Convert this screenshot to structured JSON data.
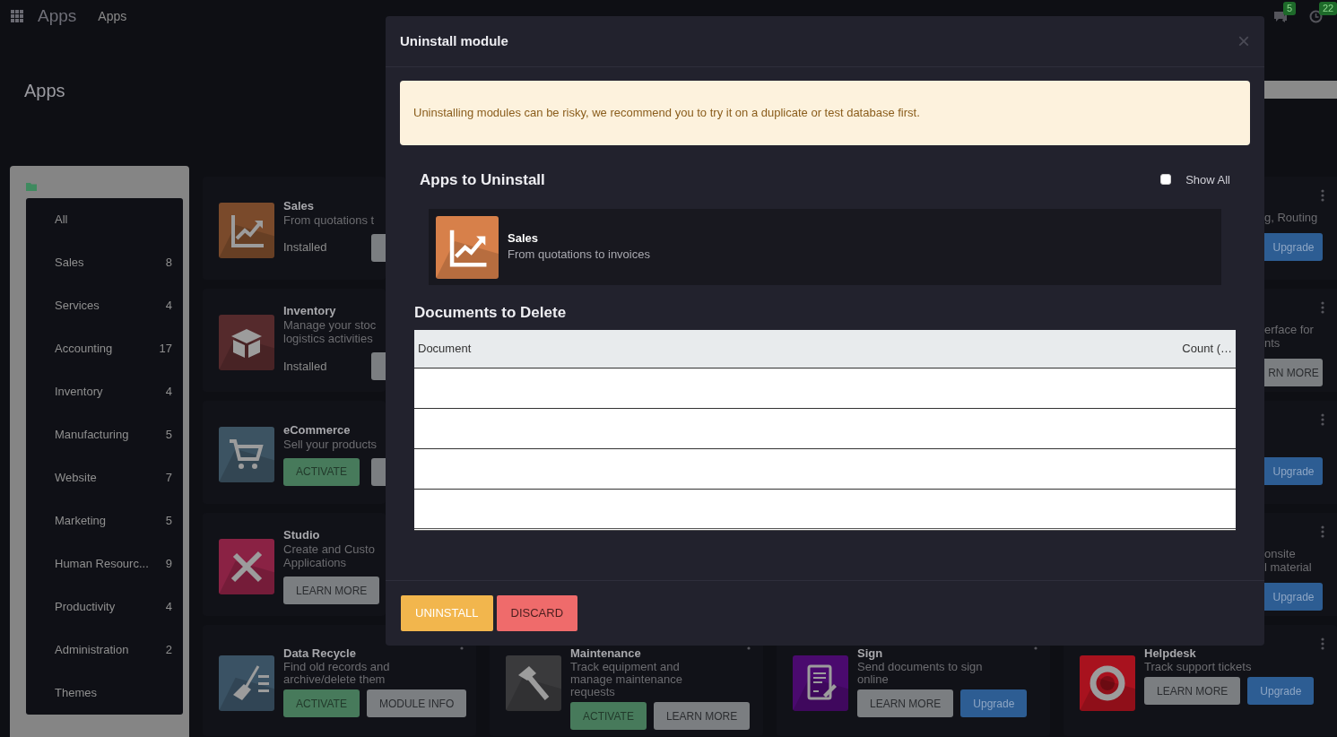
{
  "topbar": {
    "brand": "Apps",
    "menu": [
      "Apps"
    ],
    "notifications": [
      {
        "kind": "chat",
        "count": "5"
      },
      {
        "kind": "activity",
        "count": "22"
      }
    ]
  },
  "page_title": "Apps",
  "categories": [
    {
      "label": "All"
    },
    {
      "label": "Sales",
      "count": "8"
    },
    {
      "label": "Services",
      "count": "4"
    },
    {
      "label": "Accounting",
      "count": "17"
    },
    {
      "label": "Inventory",
      "count": "4"
    },
    {
      "label": "Manufacturing",
      "count": "5"
    },
    {
      "label": "Website",
      "count": "7"
    },
    {
      "label": "Marketing",
      "count": "5"
    },
    {
      "label": "Human Resourc...",
      "count": "9"
    },
    {
      "label": "Productivity",
      "count": "4"
    },
    {
      "label": "Administration",
      "count": "2"
    },
    {
      "label": "Themes"
    }
  ],
  "apps_left": [
    {
      "title": "Sales",
      "description": [
        "From quotations t"
      ],
      "kind": "chart",
      "status": "Installed",
      "buttons": [
        {
          "kind": "covered"
        }
      ]
    },
    {
      "title": "Inventory",
      "description": [
        "Manage your stoc",
        "logistics activities"
      ],
      "kind": "box",
      "status": "Installed",
      "buttons": [
        {
          "kind": "covered"
        }
      ]
    },
    {
      "title": "eCommerce",
      "description": [
        "Sell your products"
      ],
      "kind": "cart",
      "buttons": [
        {
          "kind": "activate",
          "label": "ACTIVATE"
        },
        {
          "kind": "covered"
        }
      ]
    },
    {
      "title": "Studio",
      "description": [
        "Create and Custo",
        "Applications"
      ],
      "kind": "tools",
      "buttons": [
        {
          "kind": "learn",
          "label": "LEARN MORE"
        }
      ]
    }
  ],
  "apps_bottom": [
    {
      "title": "Data Recycle",
      "description": [
        "Find old records and",
        "archive/delete them"
      ],
      "kind": "broom",
      "buttons": [
        {
          "kind": "activate",
          "label": "ACTIVATE"
        },
        {
          "kind": "learn",
          "label": "MODULE INFO"
        }
      ]
    },
    {
      "title": "Maintenance",
      "description": [
        "Track equipment and",
        "manage maintenance",
        "requests"
      ],
      "kind": "hammer",
      "buttons": [
        {
          "kind": "activate",
          "label": "ACTIVATE"
        },
        {
          "kind": "learn",
          "label": "LEARN MORE"
        }
      ]
    },
    {
      "title": "Sign",
      "description": [
        "Send documents to sign",
        "online"
      ],
      "kind": "sign",
      "buttons": [
        {
          "kind": "learn",
          "label": "LEARN MORE"
        },
        {
          "kind": "upgrade",
          "label": "Upgrade"
        }
      ]
    },
    {
      "title": "Helpdesk",
      "description": [
        "Track support tickets"
      ],
      "kind": "lifebuoy",
      "buttons": [
        {
          "kind": "learn",
          "label": "LEARN MORE"
        },
        {
          "kind": "upgrade",
          "label": "Upgrade"
        }
      ]
    }
  ],
  "apps_right_edge": [
    {
      "description": [
        "g, Routing"
      ],
      "button": {
        "kind": "upgrade",
        "label": "Upgrade"
      }
    },
    {
      "description": [
        "erface for",
        "nts"
      ],
      "button": {
        "kind": "learn",
        "label": "RN MORE"
      }
    },
    {
      "button": {
        "kind": "upgrade",
        "label": "Upgrade"
      }
    },
    {
      "description": [
        "onsite",
        "l material"
      ],
      "button": {
        "kind": "upgrade",
        "label": "Upgrade"
      }
    }
  ],
  "modal": {
    "title": "Uninstall module",
    "close": "×",
    "warning": "Uninstalling modules can be risky, we recommend you to try it on a duplicate or test database first.",
    "apps_heading": "Apps to Uninstall",
    "show_all": {
      "label": "Show All",
      "checked": false
    },
    "apps": [
      {
        "title": "Sales",
        "description": "From quotations to invoices",
        "kind": "chart"
      }
    ],
    "documents_heading": "Documents to Delete",
    "table": {
      "columns": [
        "Document",
        "Count (…"
      ],
      "rows": [
        {
          "kind": "empty"
        },
        {
          "kind": "empty"
        },
        {
          "kind": "empty"
        },
        {
          "kind": "empty"
        }
      ]
    },
    "buttons": [
      {
        "kind": "warning",
        "label": "UNINSTALL"
      },
      {
        "kind": "danger",
        "label": "DISCARD"
      }
    ]
  }
}
